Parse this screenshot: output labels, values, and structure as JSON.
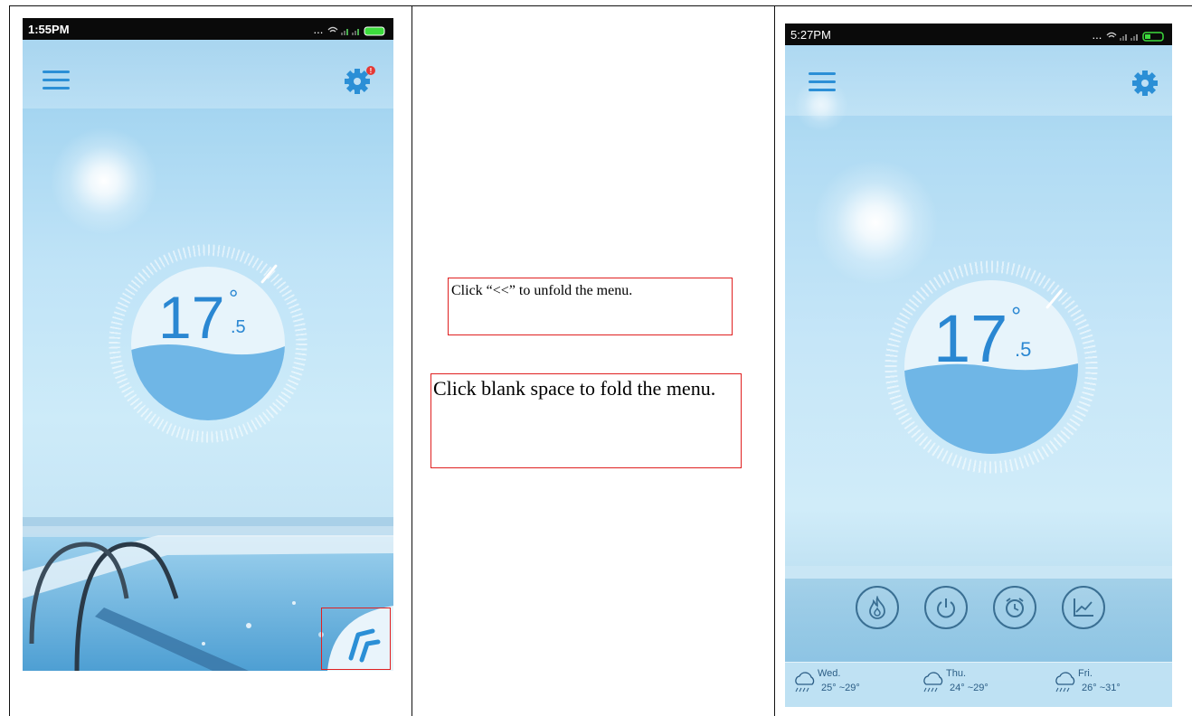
{
  "left_phone": {
    "status_time": "1:55PM",
    "status_dots": "...",
    "temperature_main": "17",
    "temperature_decimal": ".5",
    "degree_symbol": "°",
    "settings_badge": "!"
  },
  "middle": {
    "note_unfold": "Click “<<” to unfold the menu.",
    "note_fold": "Click blank space to fold the menu."
  },
  "right_phone": {
    "status_time": "5:27PM",
    "status_dots": "...",
    "temperature_main": "17",
    "temperature_decimal": ".5",
    "degree_symbol": "°",
    "menu_buttons": [
      "flame-icon",
      "power-icon",
      "alarm-clock-icon",
      "chart-icon"
    ],
    "forecast": [
      {
        "day": "Wed.",
        "range": "25° ~29°"
      },
      {
        "day": "Thu.",
        "range": "24° ~29°"
      },
      {
        "day": "Fri.",
        "range": "26° ~31°"
      }
    ]
  },
  "colors": {
    "accent": "#2b8fd6",
    "water": "#6fb6e6",
    "annotation": "#e02020"
  }
}
